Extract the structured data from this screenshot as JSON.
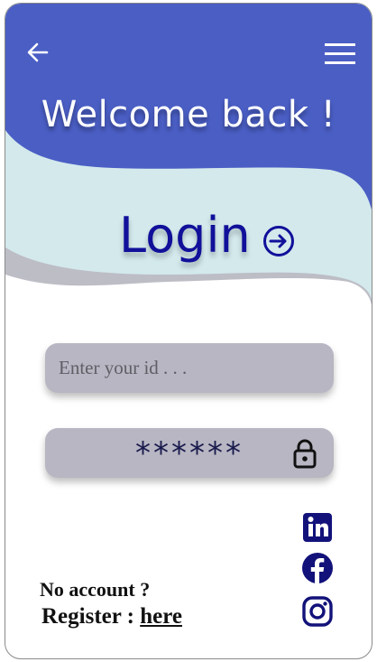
{
  "header": {
    "greeting": "Welcome back !"
  },
  "login": {
    "title": "Login"
  },
  "form": {
    "id_placeholder": "Enter your id . . .",
    "password_mask": "******"
  },
  "footer": {
    "no_account": "No account ?",
    "register_label": "Register : ",
    "register_link": "here"
  },
  "social": [
    "linkedin-icon",
    "facebook-icon",
    "instagram-icon"
  ],
  "colors": {
    "header": "#4a5ec4",
    "wave": "#d3e9ec",
    "accent": "#10109a",
    "field": "#b7b6c2"
  }
}
